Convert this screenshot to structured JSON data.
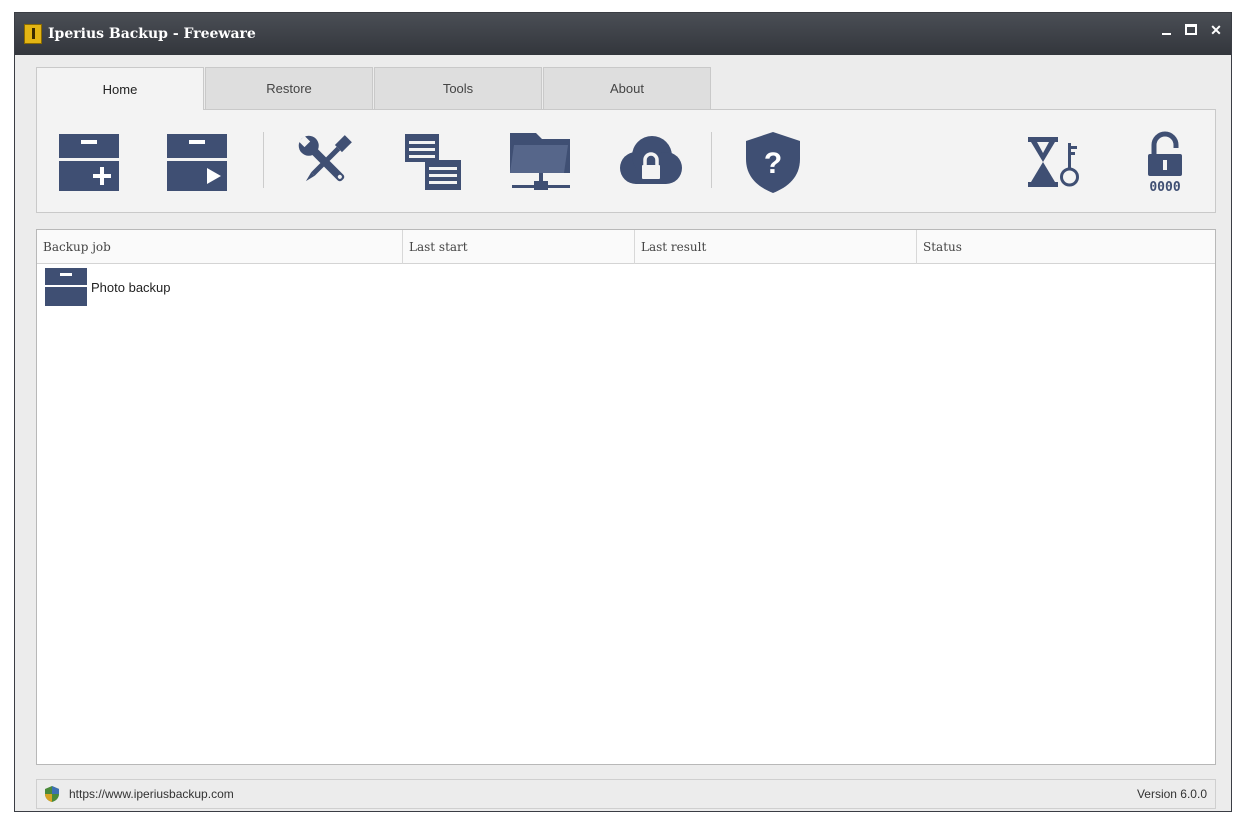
{
  "window": {
    "title": "Iperius Backup - Freeware"
  },
  "tabs": [
    {
      "label": "Home",
      "active": true
    },
    {
      "label": "Restore",
      "active": false
    },
    {
      "label": "Tools",
      "active": false
    },
    {
      "label": "About",
      "active": false
    }
  ],
  "toolbar": {
    "icons": [
      "new-backup-icon",
      "run-backup-icon",
      "settings-tools-icon",
      "list-icon",
      "network-folder-icon",
      "cloud-lock-icon",
      "help-shield-icon",
      "scheduler-key-icon",
      "unlock-code-icon"
    ],
    "unlock_code_text": "0000",
    "help_mark": "?"
  },
  "table": {
    "columns": [
      "Backup job",
      "Last start",
      "Last result",
      "Status"
    ],
    "rows": [
      {
        "name": "Photo backup",
        "last_start": "",
        "last_result": "",
        "status": ""
      }
    ]
  },
  "statusbar": {
    "url": "https://www.iperiusbackup.com",
    "version": "Version 6.0.0"
  },
  "colors": {
    "icon": "#3f4f73",
    "titlebar": "#3a3d44",
    "accent": "#e3b514"
  }
}
